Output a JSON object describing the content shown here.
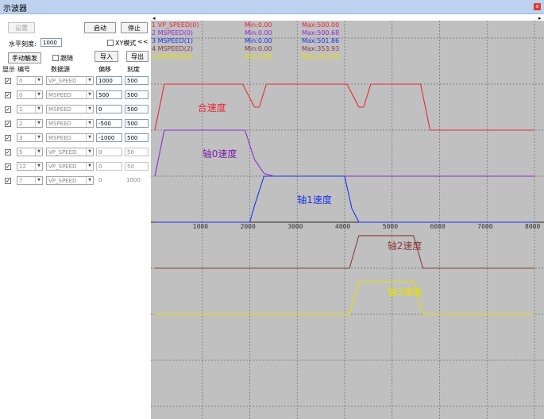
{
  "window": {
    "title": "示波器",
    "close_glyph": "x"
  },
  "toolbar": {
    "settings_label": "设置",
    "start_label": "启动",
    "stop_label": "停止",
    "hscale_label": "水平刻度:",
    "hscale_value": "1000",
    "xy_mode_label": "XY模式",
    "collapse_label": "<<",
    "manual_trigger_label": "手动触发",
    "follow_label": "跟随",
    "import_label": "导入",
    "export_label": "导出"
  },
  "channel_table": {
    "headers": [
      "显示",
      "编号",
      "数据源",
      "偏移",
      "刻度"
    ],
    "rows": [
      {
        "checked": true,
        "id": "0",
        "source": "VP_SPEED",
        "offset": "1000",
        "scale": "500",
        "enabled": true
      },
      {
        "checked": true,
        "id": "0",
        "source": "MSPEED",
        "offset": "500",
        "scale": "500",
        "enabled": true
      },
      {
        "checked": true,
        "id": "1",
        "source": "MSPEED",
        "offset": "0",
        "scale": "500",
        "enabled": true
      },
      {
        "checked": true,
        "id": "2",
        "source": "MSPEED",
        "offset": "-500",
        "scale": "500",
        "enabled": true
      },
      {
        "checked": true,
        "id": "3",
        "source": "MSPEED",
        "offset": "-1000",
        "scale": "500",
        "enabled": true
      },
      {
        "checked": true,
        "id": "5",
        "source": "VP_SPEED",
        "offset": "0",
        "scale": "50",
        "enabled": false
      },
      {
        "checked": true,
        "id": "12",
        "source": "VP_SPEED",
        "offset": "0",
        "scale": "50",
        "enabled": false
      },
      {
        "checked": true,
        "id": "7",
        "source": "VP_SPEED",
        "offset": "0",
        "scale": "1000",
        "enabled": false
      }
    ]
  },
  "legend": [
    {
      "name": "1 VP_SPEED(0)",
      "min": "Min:0.00",
      "max": "Max:500.00",
      "color": "#e8283c"
    },
    {
      "name": "2 MSPEED(0)",
      "min": "Min:0.00",
      "max": "Max:500.68",
      "color": "#8e2bd6"
    },
    {
      "name": "3 MSPEED(1)",
      "min": "Min:0.00",
      "max": "Max:501.86",
      "color": "#1d33e8"
    },
    {
      "name": "4 MSPEED(2)",
      "min": "Min:0.00",
      "max": "Max:353.93",
      "color": "#8a3a3a"
    },
    {
      "name": "5 MSPEED(3)",
      "min": "Min:0.00",
      "max": "Max:353.96",
      "color": "#e6e000"
    }
  ],
  "chart_data": {
    "type": "line",
    "xlim": [
      0,
      8000
    ],
    "x_ticks": [
      "1000",
      "2000",
      "3000",
      "4000",
      "5000",
      "6000",
      "7000",
      "8000"
    ],
    "grid": true,
    "annotations": [
      {
        "text": "合速度",
        "series": "1 VP_SPEED(0)",
        "x": 900,
        "color": "#e8283c"
      },
      {
        "text": "轴0速度",
        "series": "2 MSPEED(0)",
        "x": 1000,
        "color": "#7a1ea8"
      },
      {
        "text": "轴1速度",
        "series": "3 MSPEED(1)",
        "x": 3000,
        "color": "#1d33e8"
      },
      {
        "text": "轴2速度",
        "series": "4 MSPEED(2)",
        "x": 4900,
        "color": "#8a3a3a"
      },
      {
        "text": "轴3速度",
        "series": "5 MSPEED(3)",
        "x": 4900,
        "color": "#e6e000"
      }
    ],
    "series": [
      {
        "name": "1 VP_SPEED(0)",
        "color": "#e8283c",
        "offset": 1000,
        "scale": 500,
        "x": [
          0,
          200,
          350,
          1850,
          2100,
          2200,
          2350,
          4050,
          4300,
          4400,
          4550,
          5600,
          5800,
          8000
        ],
        "y": [
          0,
          500,
          500,
          500,
          250,
          250,
          500,
          500,
          250,
          250,
          500,
          500,
          0,
          0
        ]
      },
      {
        "name": "2 MSPEED(0)",
        "color": "#8e2bd6",
        "offset": 500,
        "scale": 500,
        "x": [
          0,
          200,
          350,
          1900,
          2100,
          2300,
          2500,
          8000
        ],
        "y": [
          0,
          500,
          500,
          500,
          180,
          30,
          0,
          0
        ]
      },
      {
        "name": "3 MSPEED(1)",
        "color": "#1d33e8",
        "offset": 0,
        "scale": 500,
        "x": [
          0,
          2000,
          2100,
          2300,
          4000,
          4150,
          4300,
          8000
        ],
        "y": [
          0,
          0,
          180,
          500,
          500,
          150,
          0,
          0
        ]
      },
      {
        "name": "4 MSPEED(2)",
        "color": "#8a3a3a",
        "offset": -500,
        "scale": 500,
        "x": [
          0,
          4100,
          4300,
          4400,
          5450,
          5650,
          8000
        ],
        "y": [
          0,
          0,
          354,
          354,
          354,
          0,
          0
        ]
      },
      {
        "name": "5 MSPEED(3)",
        "color": "#e6e000",
        "offset": -1000,
        "scale": 500,
        "x": [
          0,
          4100,
          4300,
          4400,
          5450,
          5650,
          8000
        ],
        "y": [
          0,
          0,
          354,
          354,
          354,
          0,
          0
        ]
      }
    ]
  }
}
